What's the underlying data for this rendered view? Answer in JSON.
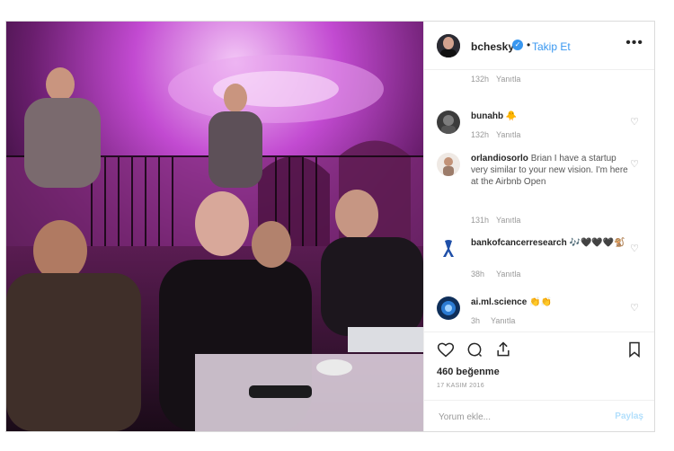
{
  "header": {
    "username": "bchesky",
    "follow_label": "Takip Et",
    "more_label": "•••"
  },
  "comments": [
    {
      "username": "",
      "text": "",
      "time": "132h",
      "reply": "Yanıtla"
    },
    {
      "username": "bunahb",
      "text": "🐥",
      "time": "132h",
      "reply": "Yanıtla"
    },
    {
      "username": "orlandiosorlo",
      "text": "Brian I have a startup very similar to your new vision. I'm here at the Airbnb Open",
      "time": "131h",
      "reply": "Yanıtla"
    },
    {
      "username": "bankofcancerresearch",
      "text": "🎶🖤🖤🖤🐒",
      "time": "38h",
      "reply": "Yanıtla"
    },
    {
      "username": "ai.ml.science",
      "text": "👏👏",
      "time": "3h",
      "reply": "Yanıtla"
    }
  ],
  "likes": "460 beğenme",
  "date": "17 KASIM 2016",
  "add_comment": {
    "placeholder": "Yorum ekle...",
    "post_label": "Paylaş"
  },
  "colors": {
    "accent": "#3897f0",
    "muted": "#999999"
  }
}
